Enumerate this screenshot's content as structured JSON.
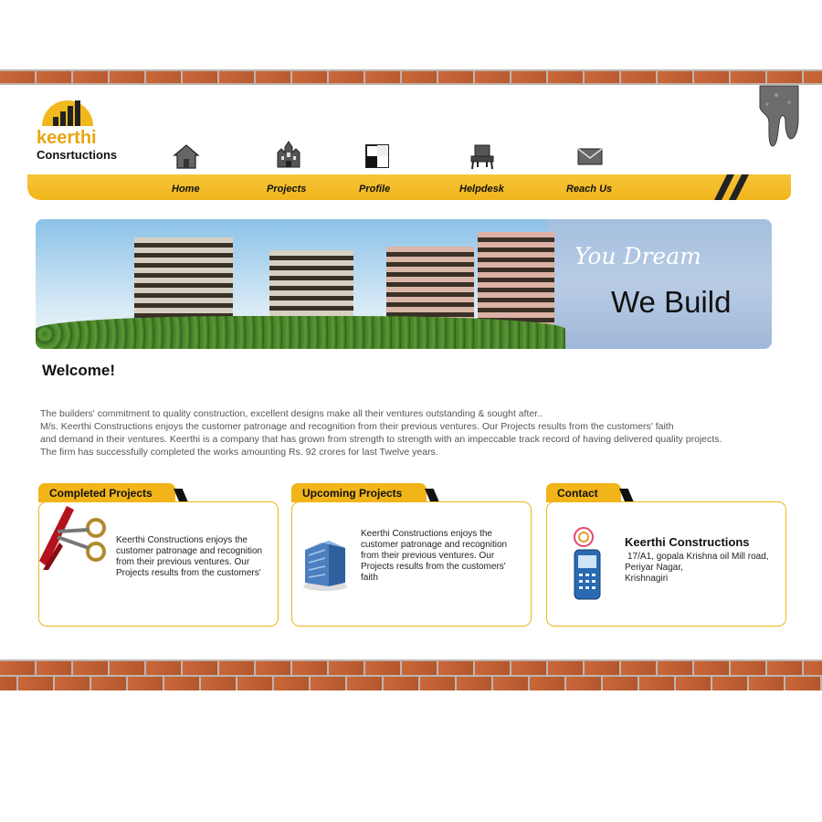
{
  "brand": {
    "name": "keerthi",
    "subtitle": "Consrtuctions"
  },
  "nav": [
    {
      "label": "Home",
      "icon": "house-icon"
    },
    {
      "label": "Projects",
      "icon": "castle-icon"
    },
    {
      "label": "Profile",
      "icon": "profile-icon"
    },
    {
      "label": "Helpdesk",
      "icon": "chair-icon"
    },
    {
      "label": "Reach Us",
      "icon": "envelope-icon"
    }
  ],
  "banner": {
    "tagline1": "You Dream",
    "tagline2": "We Build"
  },
  "welcome": {
    "title": "Welcome!",
    "lines": [
      "The builders' commitment to quality construction, excellent designs make all their ventures outstanding & sought after..",
      "M/s. Keerthi Constructions enjoys the customer patronage and recognition from their previous ventures. Our Projects results from the customers' faith",
      "and demand in their ventures. Keerthi is a company that has grown from strength to strength with an impeccable track record of having delivered quality projects.",
      "The firm has successfully completed the works amounting Rs. 92 crores for last Twelve years."
    ]
  },
  "boxes": {
    "completed": {
      "title": "Completed Projects",
      "text": "Keerthi Constructions enjoys the customer patronage and recognition from their previous ventures. Our Projects results from the customers'"
    },
    "upcoming": {
      "title": "Upcoming Projects",
      "text": "Keerthi Constructions enjoys the customer patronage and recognition from their previous ventures. Our Projects results from the customers' faith"
    },
    "contact": {
      "title": "Contact",
      "name": "Keerthi Constructions",
      "address1": "17/A1, gopala Krishna oil Mill road,",
      "address2": "Periyar Nagar,",
      "address3": "Krishnagiri"
    }
  },
  "colors": {
    "accent": "#f1b51a",
    "brick": "#c9683a",
    "banner_bg": "#a4bfdf"
  }
}
